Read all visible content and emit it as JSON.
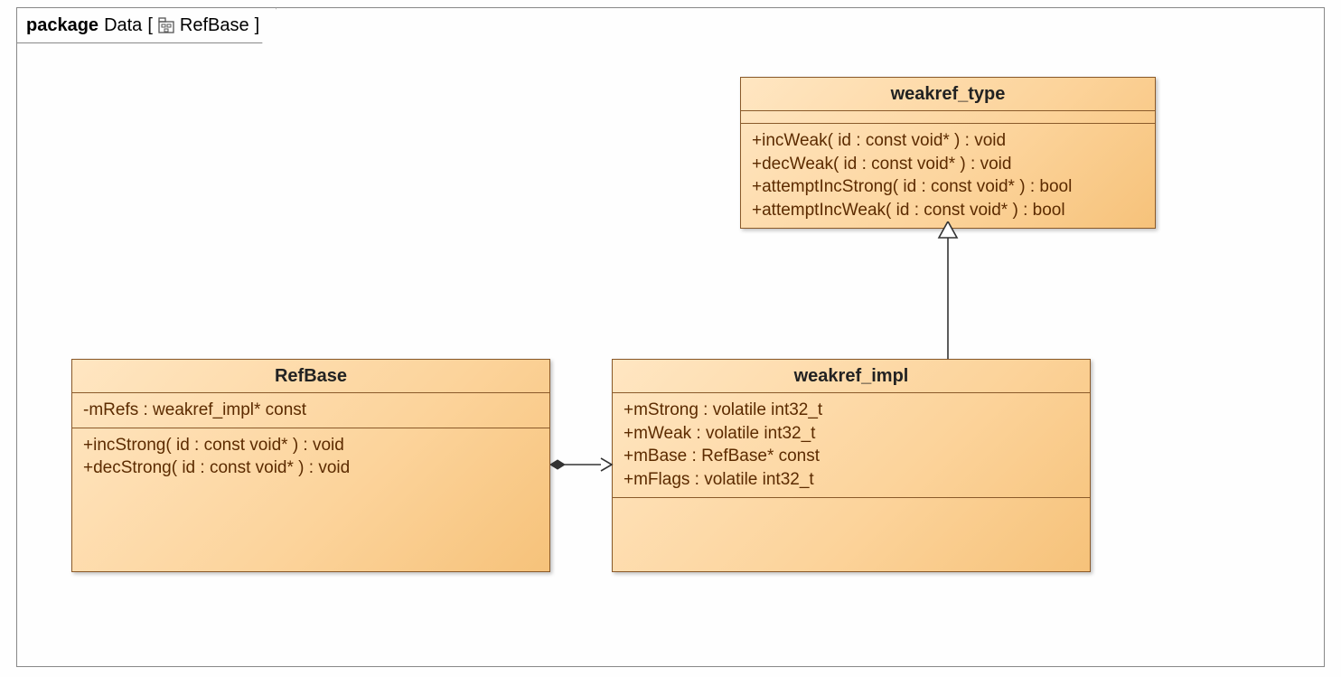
{
  "package": {
    "keyword": "package",
    "name": "Data",
    "nested": "RefBase"
  },
  "classes": {
    "weakref_type": {
      "name": "weakref_type",
      "attributes": [],
      "operations": [
        "+incWeak( id : const void* ) : void",
        "+decWeak( id : const void* ) : void",
        "+attemptIncStrong( id : const void* ) : bool",
        "+attemptIncWeak( id : const void* ) : bool"
      ]
    },
    "RefBase": {
      "name": "RefBase",
      "attributes": [
        "-mRefs : weakref_impl* const"
      ],
      "operations": [
        "+incStrong( id : const void* ) : void",
        "+decStrong( id : const void* ) : void"
      ]
    },
    "weakref_impl": {
      "name": "weakref_impl",
      "attributes": [
        "+mStrong : volatile int32_t",
        "+mWeak : volatile int32_t",
        "+mBase : RefBase* const",
        "+mFlags : volatile int32_t"
      ],
      "operations": []
    }
  },
  "relations": {
    "generalization": {
      "from": "weakref_impl",
      "to": "weakref_type"
    },
    "association": {
      "a": "RefBase",
      "b": "weakref_impl",
      "diamondAt": "RefBase",
      "arrowAt": "weakref_impl"
    }
  }
}
